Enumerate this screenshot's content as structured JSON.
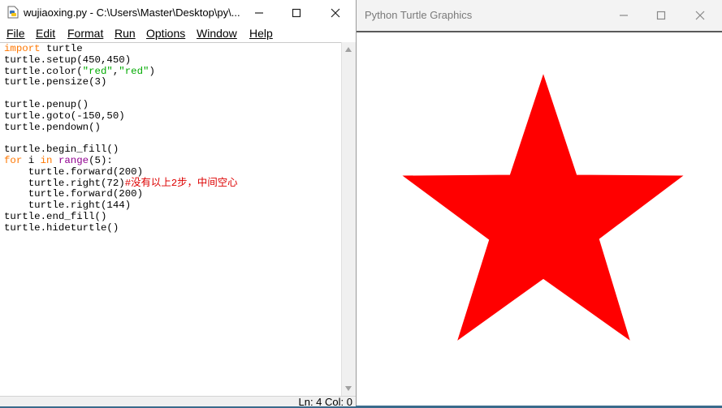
{
  "editor": {
    "title": "wujiaoxing.py - C:\\Users\\Master\\Desktop\\py\\...",
    "menu": [
      "File",
      "Edit",
      "Format",
      "Run",
      "Options",
      "Window",
      "Help"
    ],
    "status": "Ln: 4   Col: 0"
  },
  "turtle_window": {
    "title": "Python Turtle Graphics",
    "star_color": "#ff0000"
  },
  "code_lines": [
    "import turtle",
    "turtle.setup(450,450)",
    "turtle.color(\"red\",\"red\")",
    "turtle.pensize(3)",
    "",
    "turtle.penup()",
    "turtle.goto(-150,50)",
    "turtle.pendown()",
    "",
    "turtle.begin_fill()",
    "for i in range(5):",
    "    turtle.forward(200)",
    "    turtle.right(72)#没有以上2步，中间空心",
    "    turtle.forward(200)",
    "    turtle.right(144)",
    "turtle.end_fill()",
    "turtle.hideturtle()"
  ],
  "icons": {
    "minimize": "minimize-icon",
    "maximize": "maximize-icon",
    "close": "close-icon"
  }
}
